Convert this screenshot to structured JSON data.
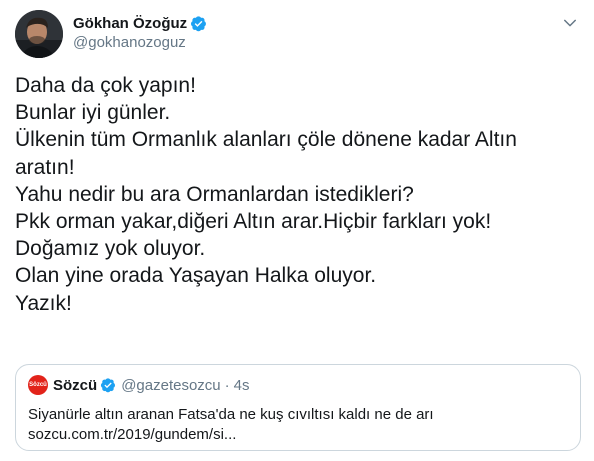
{
  "author": {
    "display_name": "Gökhan Özoğuz",
    "handle": "@gokhanozoguz",
    "avatar_icon": "avatar-photo-icon",
    "verified": true
  },
  "menu": {
    "icon": "chevron-down-icon"
  },
  "tweet": {
    "lines": [
      "Daha da çok yapın!",
      "Bunlar iyi günler.",
      "Ülkenin tüm Ormanlık alanları çöle dönene kadar Altın",
      "aratın!",
      "Yahu nedir bu ara Ormanlardan istedikleri?",
      "Pkk orman yakar,diğeri Altın arar.Hiçbir farkları yok!",
      "Doğamız yok oluyor.",
      "Olan yine orada Yaşayan Halka oluyor.",
      "Yazık!"
    ]
  },
  "quoted": {
    "logo_text": "Sözcü",
    "display_name": "Sözcü",
    "handle": "@gazetesozcu",
    "separator": "·",
    "time": "4s",
    "text": "Siyanürle altın aranan Fatsa'da ne kuş cıvıltısı kaldı ne de arı",
    "link": "sozcu.com.tr/2019/gundem/si..."
  },
  "colors": {
    "text": "#14171a",
    "secondary": "#657786",
    "verified_blue": "#1da1f2",
    "border": "#ccd6dd",
    "sozcu_red": "#e2231a"
  }
}
